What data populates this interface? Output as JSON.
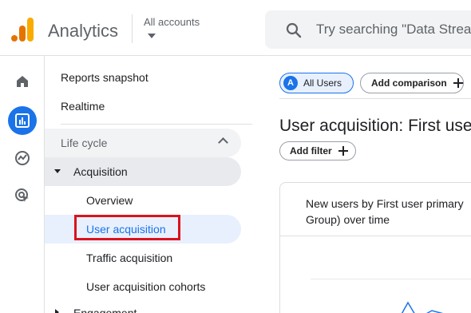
{
  "header": {
    "app_name": "Analytics",
    "accounts_label": "All accounts",
    "search_placeholder": "Try searching \"Data Strea"
  },
  "rail": {
    "items": [
      {
        "icon": "home-icon",
        "active": false
      },
      {
        "icon": "reports-icon",
        "active": true
      },
      {
        "icon": "explore-icon",
        "active": false
      },
      {
        "icon": "advertising-icon",
        "active": false
      }
    ]
  },
  "nav": {
    "reports_snapshot": "Reports snapshot",
    "realtime": "Realtime",
    "section_lifecycle": "Life cycle",
    "acquisition": "Acquisition",
    "overview": "Overview",
    "user_acquisition": "User acquisition",
    "traffic_acquisition": "Traffic acquisition",
    "user_acquisition_cohorts": "User acquisition cohorts",
    "engagement": "Engagement"
  },
  "main": {
    "chip_all_users_badge": "A",
    "chip_all_users": "All Users",
    "add_comparison": "Add comparison",
    "page_title": "User acquisition: First use",
    "add_filter": "Add filter",
    "card_title": "New users by First user primary Group) over time"
  },
  "colors": {
    "accent": "#1a73e8",
    "highlight_box": "#d9131d",
    "logo_orange": "#f9ab00",
    "logo_dark_orange": "#e37400"
  }
}
